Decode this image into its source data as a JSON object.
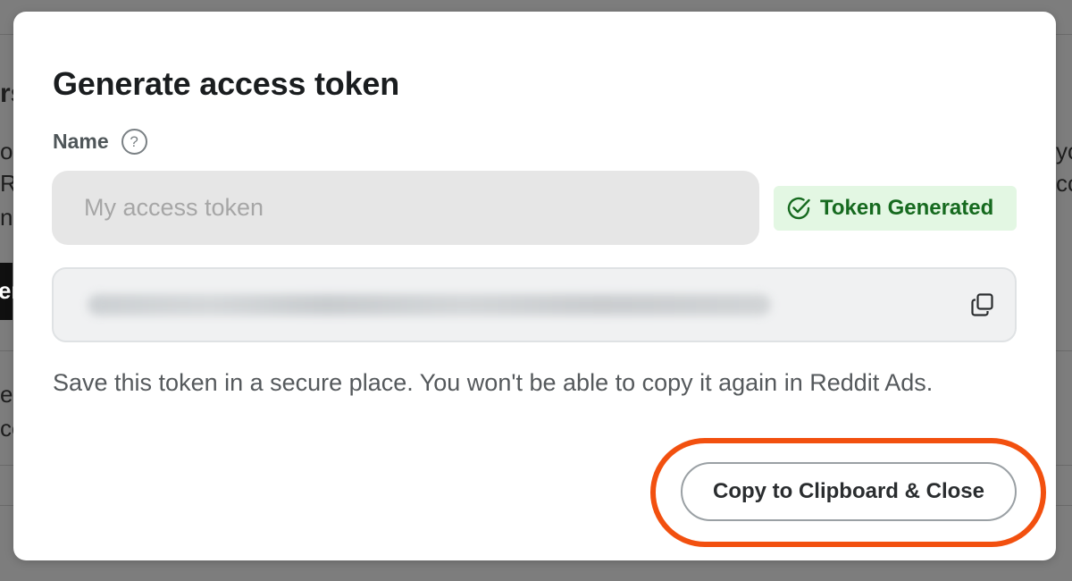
{
  "background": {
    "fragments": [
      "rs",
      "o",
      "R",
      "n",
      "e",
      "ce",
      "yo",
      "cc",
      "er"
    ]
  },
  "modal": {
    "title": "Generate access token",
    "name_label": "Name",
    "help_icon_glyph": "?",
    "name_input_placeholder": "My access token",
    "status_badge": "Token Generated",
    "token_value_hidden": true,
    "help_text": "Save this token in a secure place. You won't be able to copy it again in Reddit Ads.",
    "close_button": "Copy to Clipboard & Close"
  },
  "colors": {
    "highlight": "#f2500f",
    "status_green": "#166a1f",
    "status_bg": "#e3f7e3"
  },
  "icons": [
    "question-icon",
    "check-circle-icon",
    "copy-icon"
  ]
}
